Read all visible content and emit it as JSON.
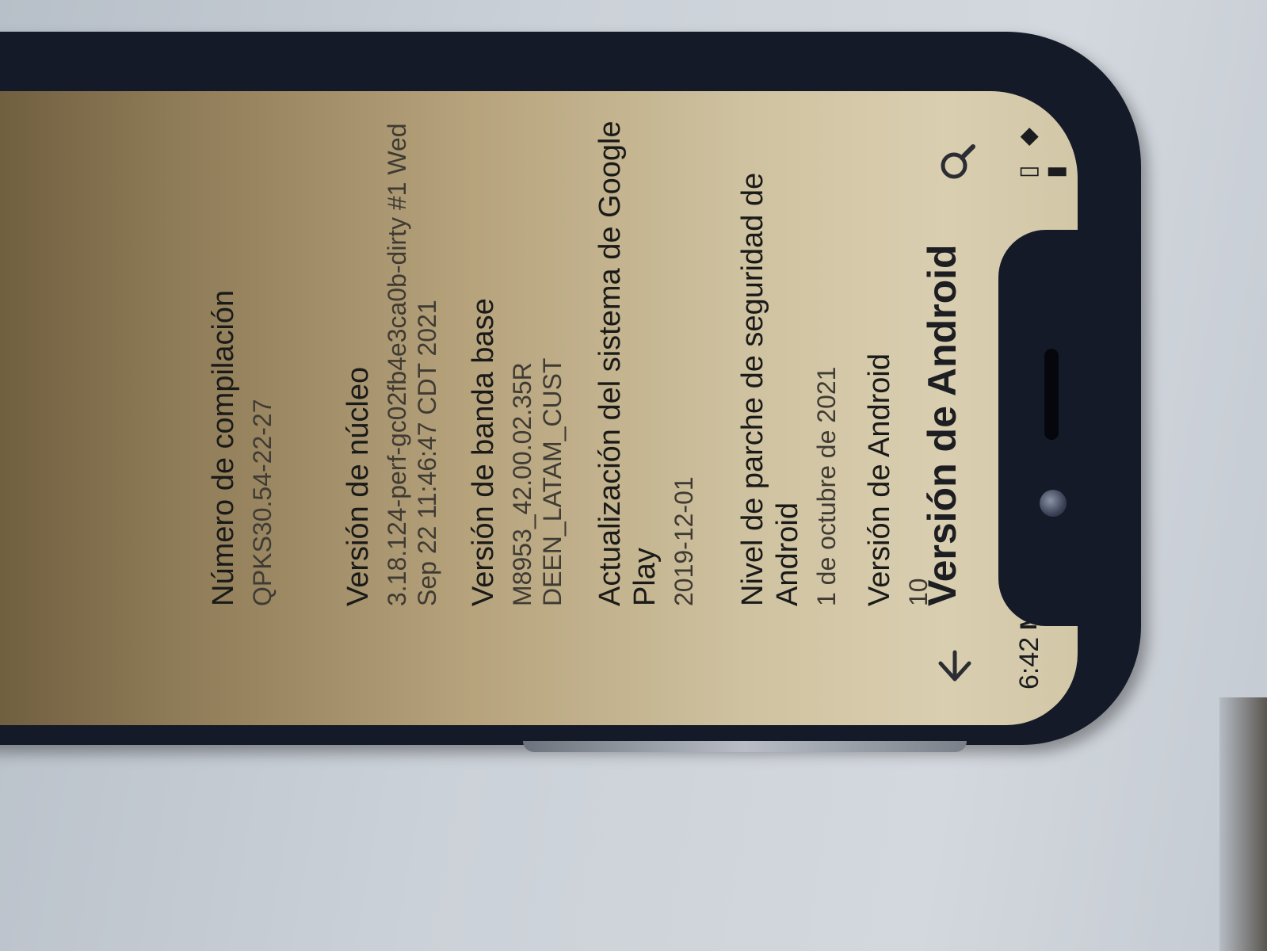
{
  "status_bar": {
    "time": "6:42",
    "notification_icon": "gmail-icon",
    "right_icons": [
      "vibrate-icon",
      "wifi-icon",
      "battery-icon"
    ]
  },
  "toolbar": {
    "back_icon": "back-arrow-icon",
    "title": "Versión de Android",
    "search_icon": "search-icon"
  },
  "items": [
    {
      "title": "Versión de Android",
      "value": "10"
    },
    {
      "title": "Nivel de parche de seguridad de Android",
      "value": "1 de octubre de 2021"
    },
    {
      "title": "Actualización del sistema de Google Play",
      "value": "2019-12-01"
    },
    {
      "title": "Versión de banda base",
      "value": "M8953_42.00.02.35R DEEN_LATAM_CUST"
    },
    {
      "title": "Versión de núcleo",
      "value": "3.18.124-perf-gc02fb4e3ca0b-dirty #1 Wed Sep 22 11:46:47 CDT 2021"
    },
    {
      "title": "Número de compilación",
      "value": "QPKS30.54-22-27"
    }
  ]
}
